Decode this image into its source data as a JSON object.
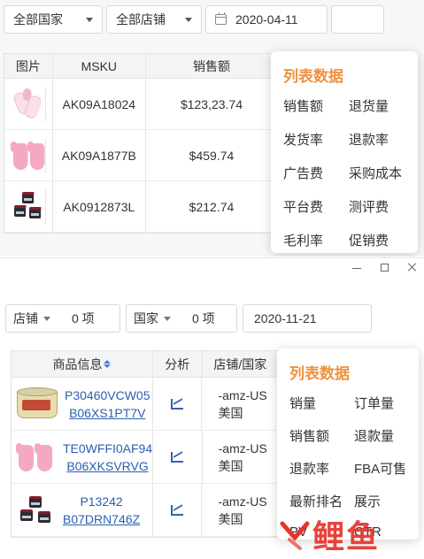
{
  "top": {
    "filters": {
      "country": "全部国家",
      "shop": "全部店铺",
      "date": "2020-04-11"
    },
    "table": {
      "headers": {
        "image": "图片",
        "msku": "MSKU",
        "sales": "销售额"
      },
      "rows": [
        {
          "msku": "AK09A18024",
          "sales": "$123,23.74",
          "image": "socks-pink-icon"
        },
        {
          "msku": "AK09A1877B",
          "sales": "$459.74",
          "image": "gloves-pink-icon"
        },
        {
          "msku": "AK0912873L",
          "sales": "$212.74",
          "image": "jars-icon"
        }
      ]
    },
    "popup": {
      "title": "列表数据",
      "items": [
        "销售额",
        "退货量",
        "发货率",
        "退款率",
        "广告费",
        "采购成本",
        "平台费",
        "测评费",
        "毛利率",
        "促销费"
      ]
    }
  },
  "bottom": {
    "filters": {
      "shop_label": "店铺",
      "shop_count": "0 项",
      "country_label": "国家",
      "country_count": "0 项",
      "date": "2020-11-21"
    },
    "table": {
      "headers": {
        "product": "商品信息",
        "analysis": "分析",
        "shop_country": "店铺/国家"
      },
      "rows": [
        {
          "code": "P30460VCW05",
          "asin": "B06XS1PT7V",
          "shop": "-amz-US",
          "country": "美国",
          "image": "cat-food-can-icon"
        },
        {
          "code": "TE0WFFI0AF94",
          "asin": "B06XKSVRVG",
          "shop": "-amz-US",
          "country": "美国",
          "image": "gloves-pink-icon"
        },
        {
          "code": "P13242",
          "asin": "B07DRN746Z",
          "shop": "-amz-US",
          "country": "美国",
          "image": "jars-icon"
        }
      ]
    },
    "popup": {
      "title": "列表数据",
      "items": [
        "销量",
        "订单量",
        "销售额",
        "退款量",
        "退款率",
        "FBA可售",
        "最新排名",
        "展示",
        "PV",
        "CTR"
      ]
    },
    "watermark": "鲤鱼"
  },
  "colors": {
    "accent_orange": "#f0913d",
    "link_blue": "#2b5fb0",
    "watermark_red": "#e8332d"
  }
}
